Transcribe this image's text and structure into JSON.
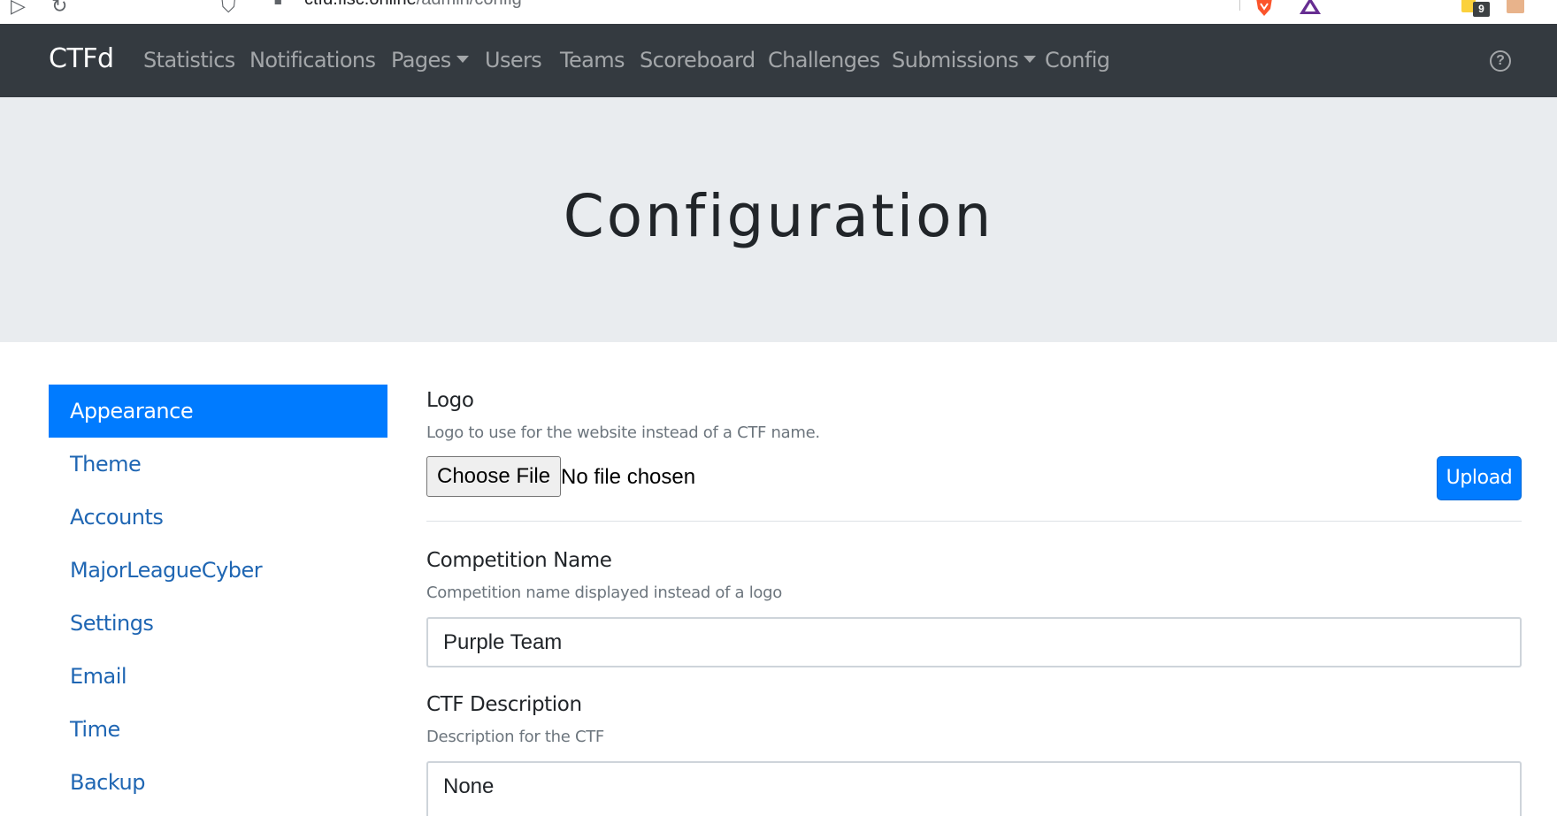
{
  "browser": {
    "url_host": "ctfd.fisc.online",
    "url_path": "/admin/config",
    "extension_badge": "9"
  },
  "navbar": {
    "brand": "CTFd",
    "links": [
      {
        "label": "Statistics"
      },
      {
        "label": "Notifications"
      },
      {
        "label": "Pages",
        "dropdown": true
      },
      {
        "label": "Users"
      },
      {
        "label": "Teams"
      },
      {
        "label": "Scoreboard"
      },
      {
        "label": "Challenges"
      },
      {
        "label": "Submissions",
        "dropdown": true
      },
      {
        "label": "Config"
      }
    ],
    "help_glyph": "?"
  },
  "header": {
    "title": "Configuration"
  },
  "sidebar": {
    "items": [
      {
        "label": "Appearance",
        "active": true
      },
      {
        "label": "Theme"
      },
      {
        "label": "Accounts"
      },
      {
        "label": "MajorLeagueCyber"
      },
      {
        "label": "Settings"
      },
      {
        "label": "Email"
      },
      {
        "label": "Time"
      },
      {
        "label": "Backup"
      }
    ]
  },
  "form": {
    "logo": {
      "label": "Logo",
      "help": "Logo to use for the website instead of a CTF name.",
      "choose_file_label": "Choose File",
      "file_status": "No file chosen",
      "upload_label": "Upload"
    },
    "competition_name": {
      "label": "Competition Name",
      "help": "Competition name displayed instead of a logo",
      "value": "Purple Team"
    },
    "ctf_description": {
      "label": "CTF Description",
      "help": "Description for the CTF",
      "value": "None"
    }
  },
  "colors": {
    "navbar_bg": "#343a40",
    "jumbotron_bg": "#e9ecef",
    "primary": "#007bff",
    "link": "#1f66b3"
  }
}
